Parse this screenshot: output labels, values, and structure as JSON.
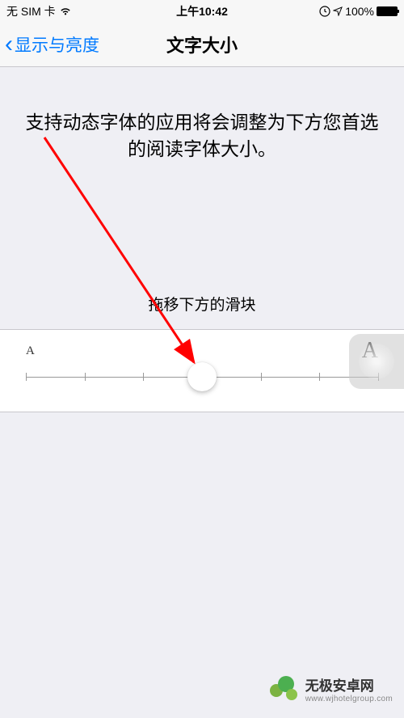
{
  "status": {
    "carrier": "无 SIM 卡",
    "time": "上午10:42",
    "battery_pct": "100%"
  },
  "nav": {
    "back_label": "显示与亮度",
    "title": "文字大小"
  },
  "body": {
    "description": "支持动态字体的应用将会调整为下方您首选的阅读字体大小。",
    "slider_instruction": "拖移下方的滑块",
    "small_a": "A",
    "large_a": "A",
    "slider_ticks": 7,
    "slider_position_index": 3
  },
  "watermark": {
    "title": "无极安卓网",
    "url": "www.wjhotelgroup.com"
  }
}
